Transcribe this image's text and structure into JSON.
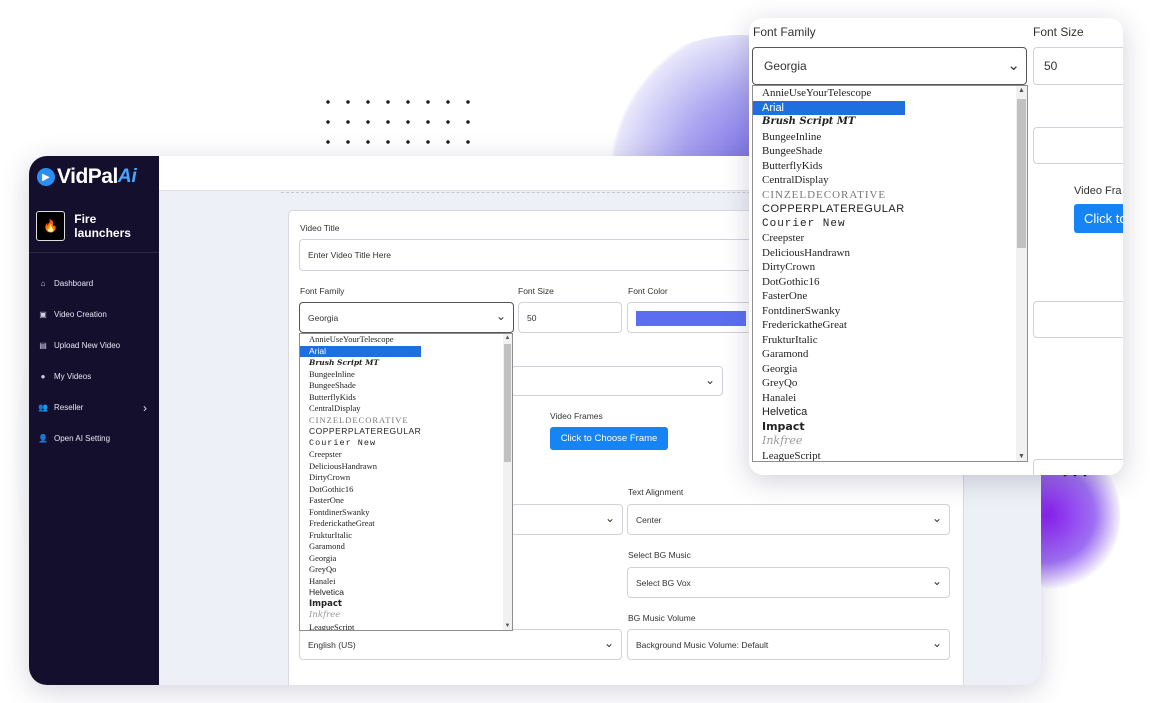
{
  "app": {
    "logo_main": "VidPal",
    "logo_ai": "Ai",
    "brand_name": "Fire launchers"
  },
  "sidebar": {
    "items": [
      {
        "label": "Dashboard",
        "icon": "home-icon"
      },
      {
        "label": "Video Creation",
        "icon": "video-icon"
      },
      {
        "label": "Upload New Video",
        "icon": "upload-icon"
      },
      {
        "label": "My Videos",
        "icon": "play-icon"
      },
      {
        "label": "Reseller",
        "icon": "users-icon"
      },
      {
        "label": "Open AI Setting",
        "icon": "user-gear-icon"
      }
    ]
  },
  "form": {
    "video_title_label": "Video Title",
    "video_title_placeholder": "Enter Video Title Here",
    "font_family_label": "Font Family",
    "font_family_value": "Georgia",
    "font_size_label": "Font Size",
    "font_size_value": "50",
    "font_color_label": "Font Color",
    "font_color_value": "#5b6df0",
    "video_frames_label": "Video Frames",
    "choose_frame_button": "Click to Choose Frame",
    "text_alignment_label": "Text Alignment",
    "text_alignment_value": "Center",
    "bg_music_label": "Select BG Music",
    "bg_music_value": "Select BG Vox",
    "bg_volume_label": "BG Music Volume",
    "bg_volume_value": "Background Music Volume: Default",
    "language_value": "English (US)"
  },
  "zoom": {
    "font_family_label": "Font Family",
    "font_family_value": "Georgia",
    "font_size_label": "Font Size",
    "font_size_value": "50",
    "video_frames_label": "Video Fra",
    "choose_frame_button": "Click to"
  },
  "fonts": [
    "AnnieUseYourTelescope",
    "Arial",
    "Brush Script MT",
    "BungeeInline",
    "BungeeShade",
    "ButterflyKids",
    "CentralDisplay",
    "CINZELDECORATIVE",
    "COPPERPLATEREGULAR",
    "Courier New",
    "Creepster",
    "DeliciousHandrawn",
    "DirtyCrown",
    "DotGothic16",
    "FasterOne",
    "FontdinerSwanky",
    "FrederickatheGreat",
    "FrukturItalic",
    "Garamond",
    "Georgia",
    "GreyQo",
    "Hanalei",
    "Helvetica",
    "Impact",
    "Inkfree",
    "LeagueScript"
  ],
  "selected_font": "Arial",
  "colors": {
    "sidebar_bg": "#150f2e",
    "accent": "#1684f5",
    "selection": "#1f6fde"
  }
}
